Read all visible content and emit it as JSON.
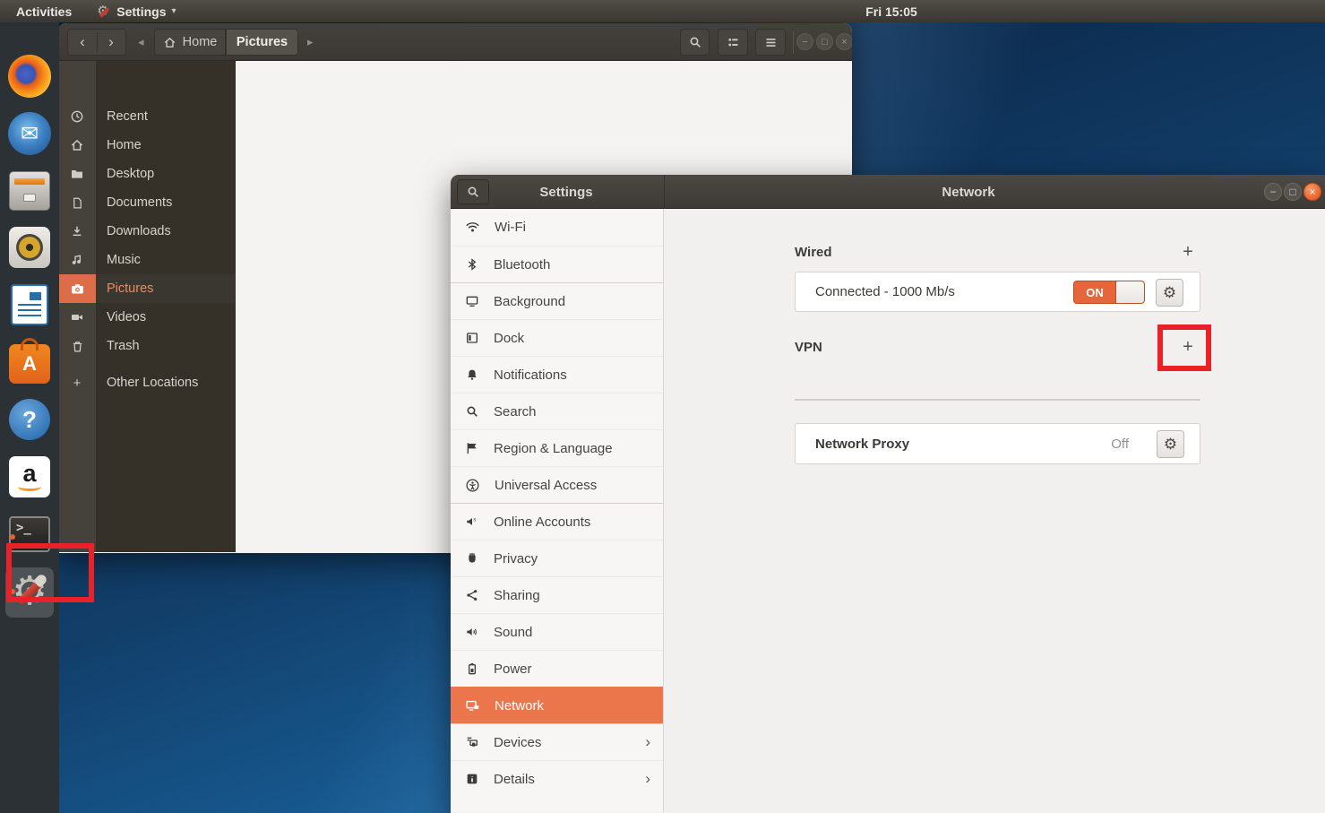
{
  "top_bar": {
    "activities_label": "Activities",
    "app_menu_label": "Settings",
    "caret_glyph": "▾",
    "clock": "Fri 15:05"
  },
  "glyphs": {
    "back": "‹",
    "forward": "›",
    "path_left": "◂",
    "path_right": "▸",
    "minimize": "−",
    "maximize": "□",
    "close": "×",
    "gear": "⚙",
    "plus": "+",
    "chevron_right": "›",
    "envelope": "✉",
    "question": "?",
    "software_letter": "A",
    "amazon_letter": "a",
    "terminal_prompt": ">_"
  },
  "dock": {
    "items": [
      {
        "app": "firefox"
      },
      {
        "app": "thunderbird"
      },
      {
        "app": "files",
        "running": true
      },
      {
        "app": "rhythmbox"
      },
      {
        "app": "libreoffice-writer"
      },
      {
        "app": "ubuntu-software"
      },
      {
        "app": "help"
      },
      {
        "app": "amazon"
      },
      {
        "app": "terminal",
        "running": true
      },
      {
        "app": "settings",
        "running": true,
        "active": true
      }
    ]
  },
  "files_window": {
    "toolbar": {
      "home_label": "Home",
      "current_folder": "Pictures"
    },
    "sidebar": {
      "selected": "Pictures",
      "items": [
        {
          "label": "Recent",
          "icon": "clock-icon"
        },
        {
          "label": "Home",
          "icon": "home-icon"
        },
        {
          "label": "Desktop",
          "icon": "folder-icon"
        },
        {
          "label": "Documents",
          "icon": "document-icon"
        },
        {
          "label": "Downloads",
          "icon": "download-icon"
        },
        {
          "label": "Music",
          "icon": "music-icon"
        },
        {
          "label": "Pictures",
          "icon": "camera-icon"
        },
        {
          "label": "Videos",
          "icon": "video-icon"
        },
        {
          "label": "Trash",
          "icon": "trash-icon"
        },
        {
          "label": "Other Locations",
          "icon": "plus-icon"
        }
      ]
    }
  },
  "settings_window": {
    "header": {
      "left_title": "Settings",
      "right_title": "Network"
    },
    "sidebar": {
      "selected": "Network",
      "items": [
        {
          "label": "Wi-Fi",
          "icon": "wifi-icon"
        },
        {
          "label": "Bluetooth",
          "icon": "bluetooth-icon"
        },
        {
          "label": "Background",
          "icon": "background-icon"
        },
        {
          "label": "Dock",
          "icon": "dock-icon"
        },
        {
          "label": "Notifications",
          "icon": "bell-icon"
        },
        {
          "label": "Search",
          "icon": "search-icon"
        },
        {
          "label": "Region & Language",
          "icon": "flag-icon"
        },
        {
          "label": "Universal Access",
          "icon": "accessibility-icon"
        },
        {
          "label": "Online Accounts",
          "icon": "online-accounts-icon"
        },
        {
          "label": "Privacy",
          "icon": "hand-icon"
        },
        {
          "label": "Sharing",
          "icon": "share-icon"
        },
        {
          "label": "Sound",
          "icon": "speaker-icon"
        },
        {
          "label": "Power",
          "icon": "battery-icon"
        },
        {
          "label": "Network",
          "icon": "network-icon",
          "selected": true
        },
        {
          "label": "Devices",
          "icon": "devices-icon",
          "chevron": true
        },
        {
          "label": "Details",
          "icon": "info-icon",
          "chevron": true
        }
      ]
    },
    "network_panel": {
      "wired": {
        "title": "Wired",
        "row_label": "Connected - 1000 Mb/s",
        "toggle_state": "ON"
      },
      "vpn": {
        "title": "VPN"
      },
      "proxy": {
        "title": "Network Proxy",
        "status": "Off"
      }
    }
  },
  "annotations": {
    "boxes": [
      {
        "target": "dock-settings-icon"
      },
      {
        "target": "vpn-add-button"
      }
    ],
    "color": "#ea2127"
  },
  "colors": {
    "accent_orange": "#ec764b",
    "toggle_on_orange": "#e4663a",
    "annotation_red": "#ea2127",
    "selected_sidebar_orange": "#dd6d48"
  }
}
